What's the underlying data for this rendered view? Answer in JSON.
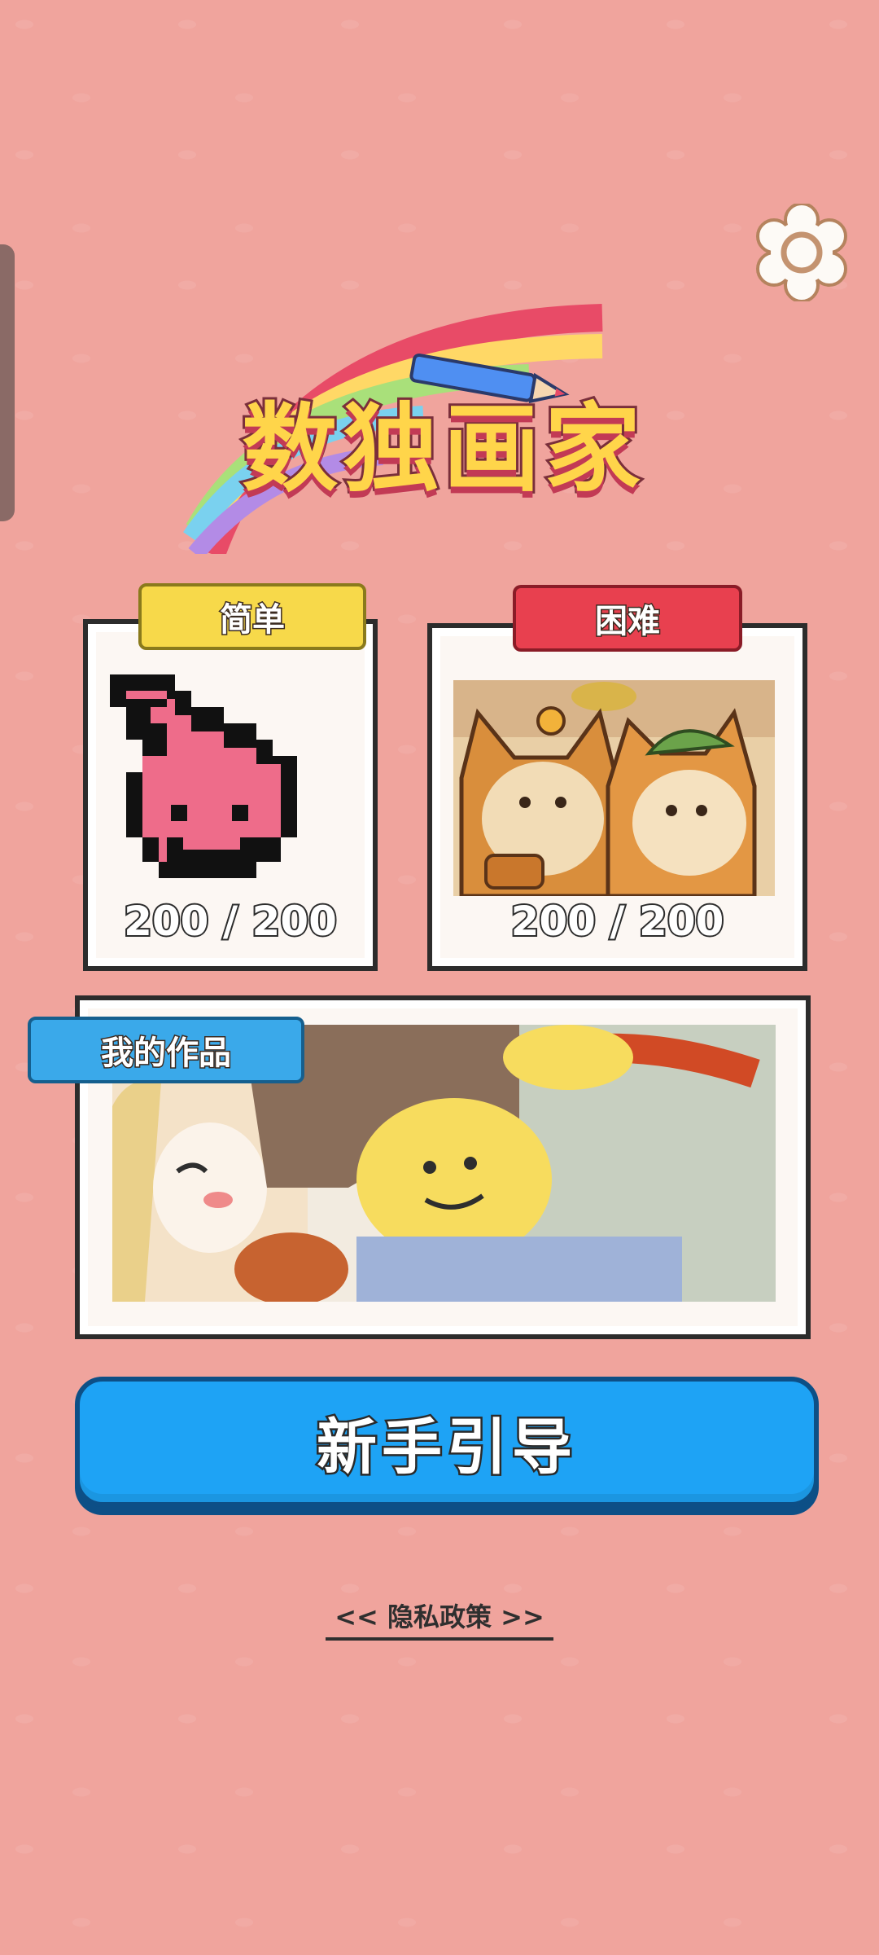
{
  "app": {
    "title": "数独画家"
  },
  "settings": {
    "icon": "gear-icon"
  },
  "modes": [
    {
      "id": "easy",
      "label": "简单",
      "progress": "200 / 200",
      "ribbon_color": "#f7d94a"
    },
    {
      "id": "hard",
      "label": "困难",
      "progress": "200 / 200",
      "ribbon_color": "#e8404f"
    }
  ],
  "works": {
    "label": "我的作品",
    "ribbon_color": "#3aa9ea"
  },
  "tutorial_button": {
    "label": "新手引导",
    "color": "#1ea3f5"
  },
  "privacy_link": {
    "label": "<< 隐私政策 >>"
  }
}
